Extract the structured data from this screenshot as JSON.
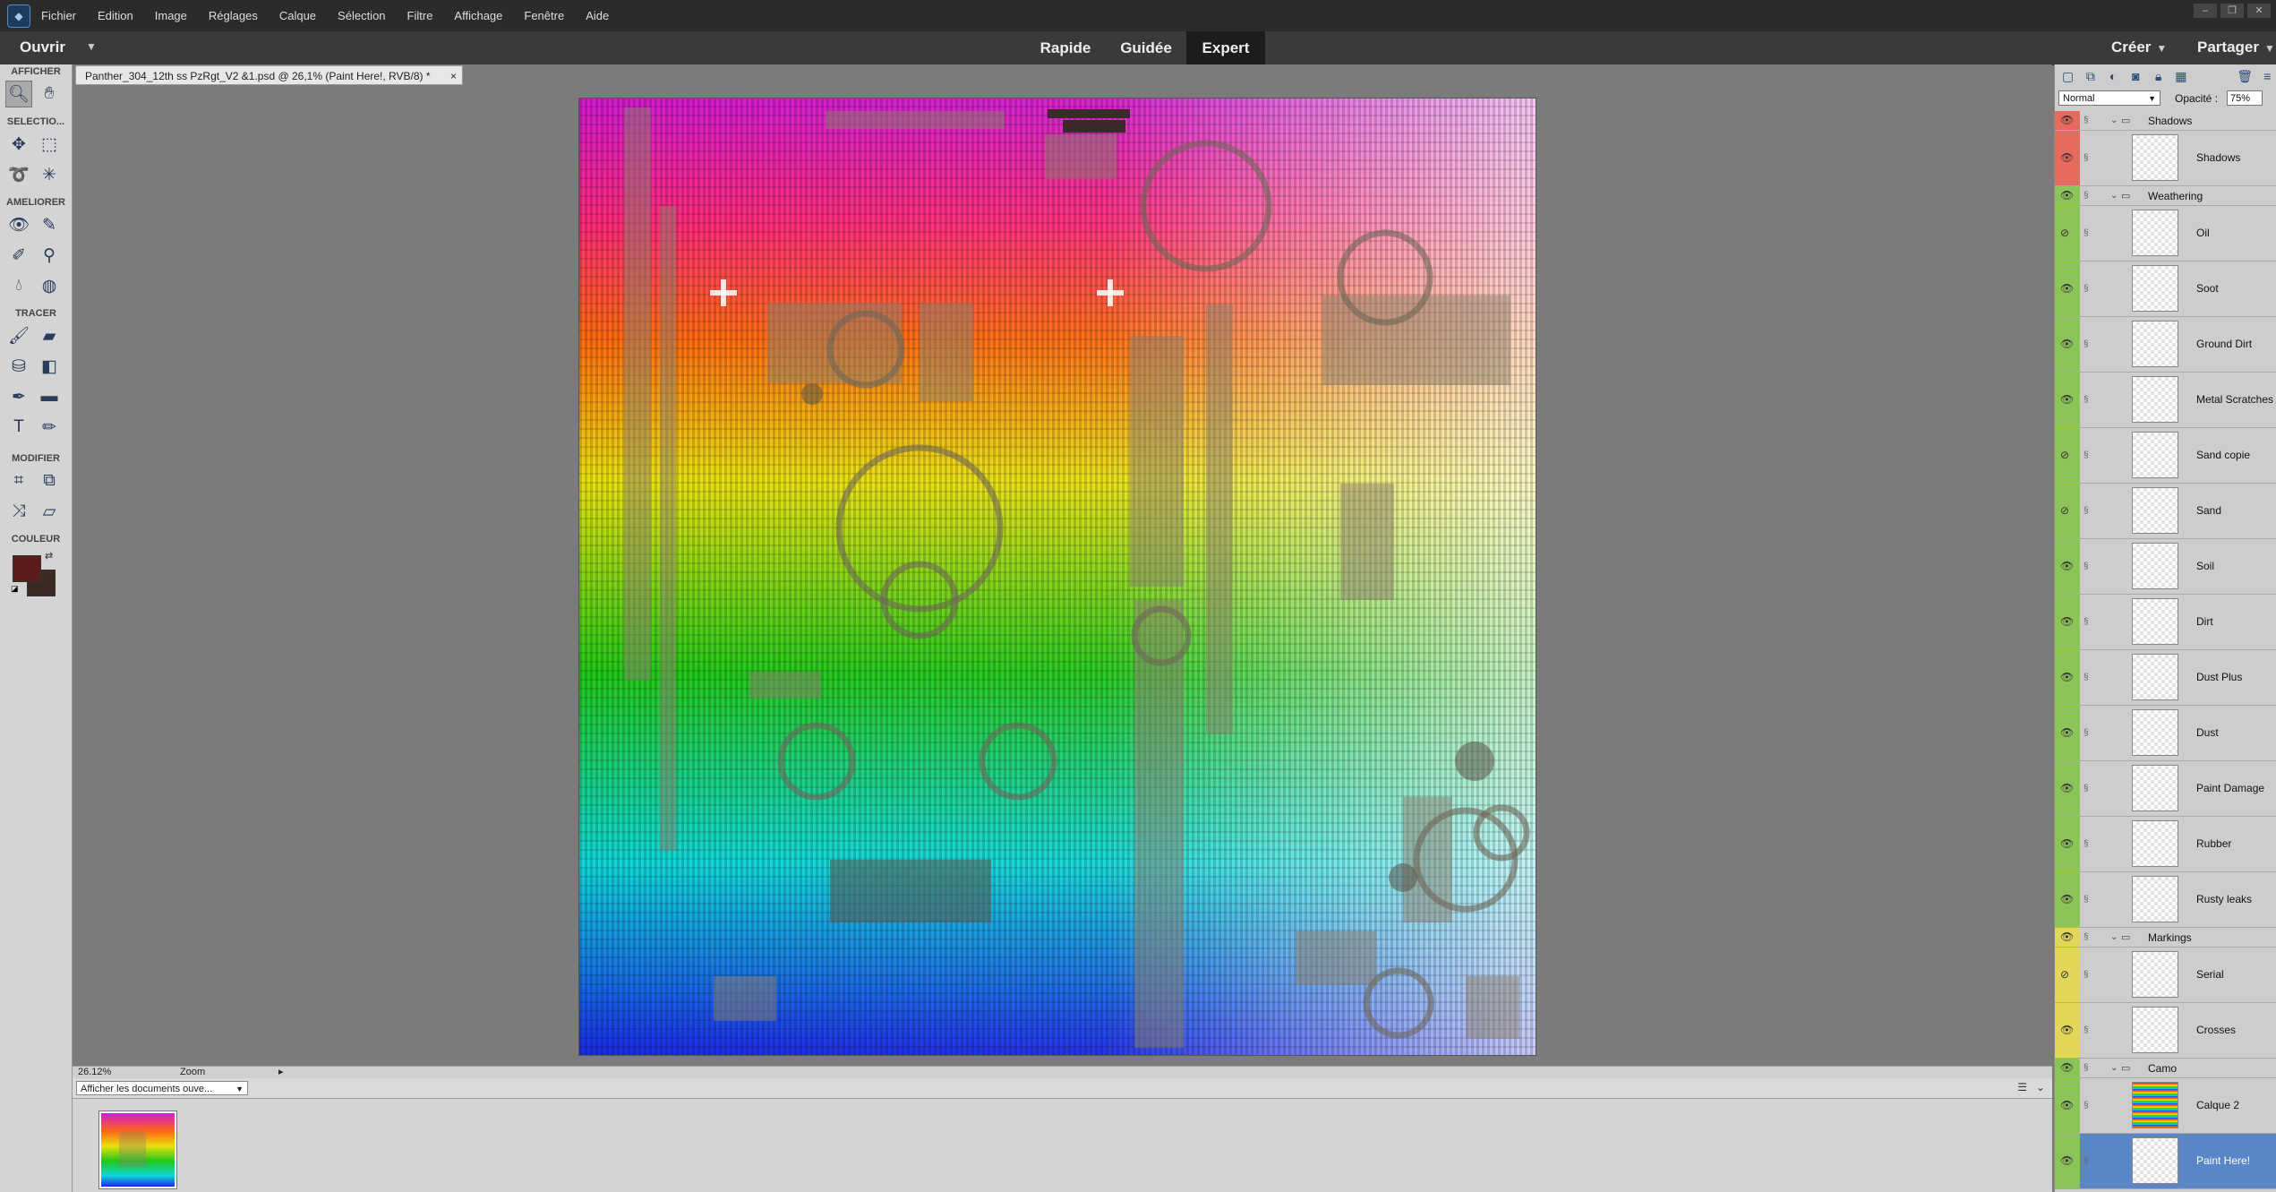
{
  "menubar": {
    "items": [
      "Fichier",
      "Edition",
      "Image",
      "Réglages",
      "Calque",
      "Sélection",
      "Filtre",
      "Affichage",
      "Fenêtre",
      "Aide"
    ]
  },
  "modebar": {
    "open": "Ouvrir",
    "modes": [
      "Rapide",
      "Guidée",
      "Expert"
    ],
    "active_mode": "Expert",
    "create": "Créer",
    "share": "Partager"
  },
  "toolbox": {
    "sections": [
      "AFFICHER",
      "SELECTIO...",
      "AMELIORER",
      "TRACER",
      "MODIFIER",
      "COULEUR"
    ],
    "foreground_color": "#5a1c1c",
    "background_color": "#3b2a22"
  },
  "document": {
    "tab_title": "Panther_304_12th ss PzRgt_V2 &1.psd @ 26,1% (Paint Here!, RVB/8) *",
    "close": "×"
  },
  "status": {
    "zoom": "26.12%",
    "zoom_label": "Zoom"
  },
  "bin": {
    "select_label": "Afficher les documents ouve..."
  },
  "layers_panel": {
    "blend_mode": "Normal",
    "opacity_label": "Opacité :",
    "opacity": "75%",
    "layers": [
      {
        "name": "Shadows",
        "type": "group",
        "stripe": "#e86a5e",
        "visible": true
      },
      {
        "name": "Shadows",
        "type": "layer",
        "stripe": "#e86a5e",
        "visible": true
      },
      {
        "name": "Weathering",
        "type": "group",
        "stripe": "#8dc45a",
        "visible": true
      },
      {
        "name": "Oil",
        "type": "layer",
        "stripe": "#8dc45a",
        "visible": false
      },
      {
        "name": "Soot",
        "type": "layer",
        "stripe": "#8dc45a",
        "visible": true
      },
      {
        "name": "Ground Dirt",
        "type": "layer",
        "stripe": "#8dc45a",
        "visible": true
      },
      {
        "name": "Metal Scratches",
        "type": "layer",
        "stripe": "#8dc45a",
        "visible": true
      },
      {
        "name": "Sand copie",
        "type": "layer",
        "stripe": "#8dc45a",
        "visible": false
      },
      {
        "name": "Sand",
        "type": "layer",
        "stripe": "#8dc45a",
        "visible": false
      },
      {
        "name": "Soil",
        "type": "layer",
        "stripe": "#8dc45a",
        "visible": true
      },
      {
        "name": "Dirt",
        "type": "layer",
        "stripe": "#8dc45a",
        "visible": true
      },
      {
        "name": "Dust Plus",
        "type": "layer",
        "stripe": "#8dc45a",
        "visible": true
      },
      {
        "name": "Dust",
        "type": "layer",
        "stripe": "#8dc45a",
        "visible": true
      },
      {
        "name": "Paint Damage",
        "type": "layer",
        "stripe": "#8dc45a",
        "visible": true
      },
      {
        "name": "Rubber",
        "type": "layer",
        "stripe": "#8dc45a",
        "visible": true
      },
      {
        "name": "Rusty leaks",
        "type": "layer",
        "stripe": "#8dc45a",
        "visible": true
      },
      {
        "name": "Markings",
        "type": "group",
        "stripe": "#e3d75a",
        "visible": true
      },
      {
        "name": "Serial",
        "type": "layer",
        "stripe": "#e3d75a",
        "visible": false
      },
      {
        "name": "Crosses",
        "type": "layer",
        "stripe": "#e3d75a",
        "visible": true
      },
      {
        "name": "Camo",
        "type": "group",
        "stripe": "#8dc45a",
        "visible": true
      },
      {
        "name": "Calque 2",
        "type": "layer",
        "stripe": "#8dc45a",
        "visible": true
      },
      {
        "name": "Paint Here!",
        "type": "layer",
        "stripe": "#8dc45a",
        "visible": true,
        "selected": true
      }
    ]
  }
}
